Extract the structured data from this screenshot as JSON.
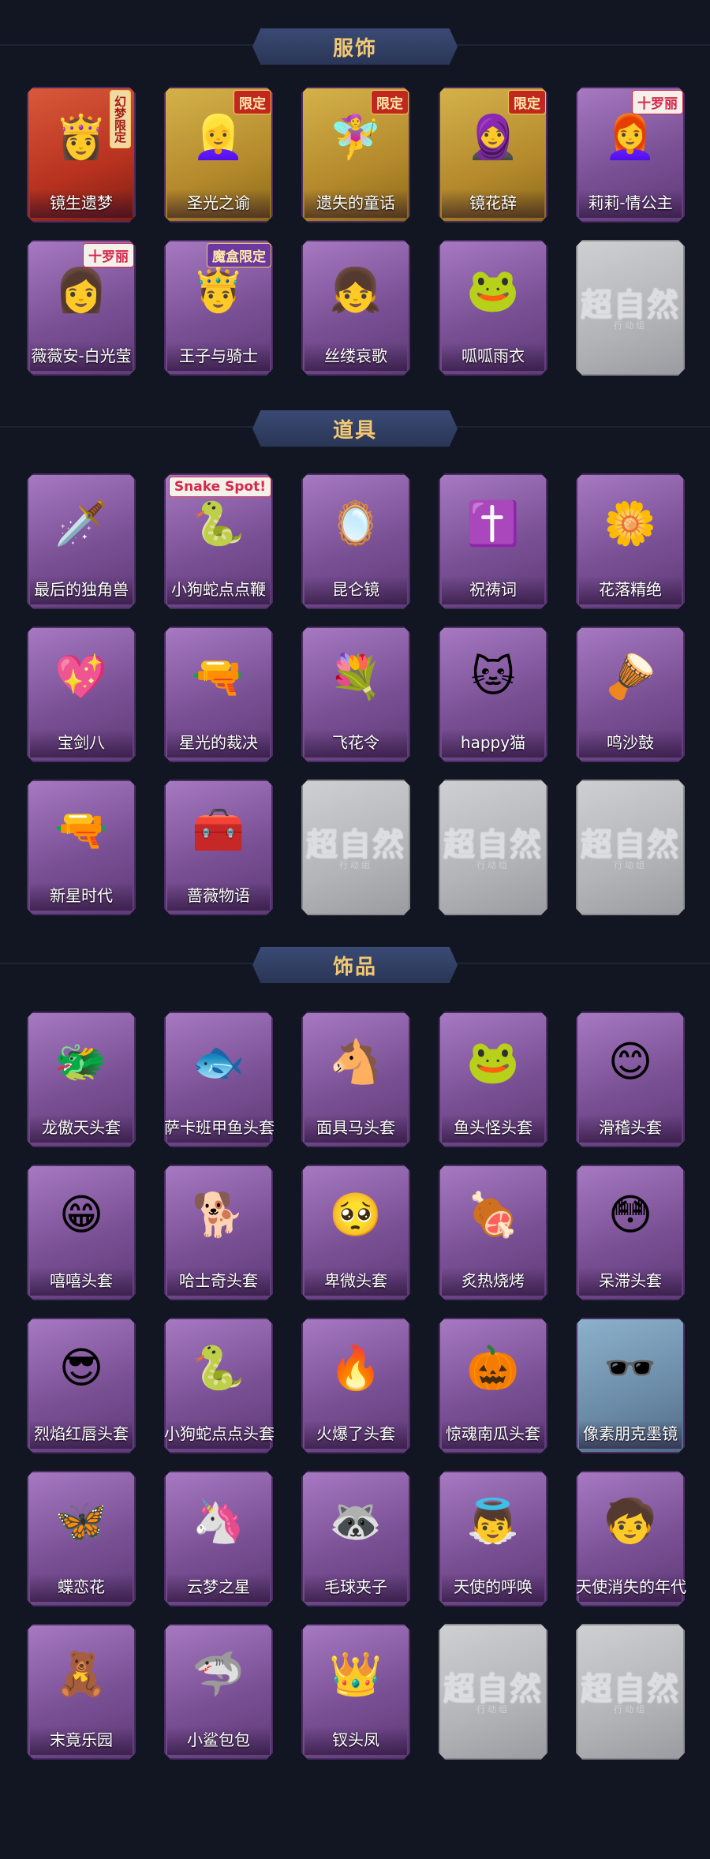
{
  "sections": [
    {
      "title": "服饰",
      "items": [
        {
          "label": "镜生遗梦",
          "icon": "👸",
          "style": "red",
          "badge": "幻梦限定",
          "badge_style": "vert"
        },
        {
          "label": "圣光之谕",
          "icon": "👱‍♀️",
          "style": "gold",
          "badge": "限定",
          "badge_style": ""
        },
        {
          "label": "遗失的童话",
          "icon": "🧚‍♀️",
          "style": "gold",
          "badge": "限定",
          "badge_style": ""
        },
        {
          "label": "镜花辞",
          "icon": "🧕",
          "style": "gold",
          "badge": "限定",
          "badge_style": ""
        },
        {
          "label": "莉莉-情公主",
          "icon": "👩‍🦰",
          "style": "purple",
          "badge": "十罗丽",
          "badge_style": "pink"
        },
        {
          "label": "薇薇安-白光莹",
          "icon": "👩",
          "style": "purple",
          "badge": "十罗丽",
          "badge_style": "pink"
        },
        {
          "label": "王子与骑士",
          "icon": "🤴",
          "style": "purple",
          "badge": "魔盒限定",
          "badge_style": "teal"
        },
        {
          "label": "丝缕哀歌",
          "icon": "👧",
          "style": "purple",
          "badge": "",
          "badge_style": ""
        },
        {
          "label": "呱呱雨衣",
          "icon": "🐸",
          "style": "purple",
          "badge": "",
          "badge_style": ""
        },
        {
          "label": "",
          "icon": "",
          "style": "grey",
          "badge": "",
          "badge_style": "",
          "placeholder": "超自然",
          "placeholder_sub": "行动组"
        }
      ]
    },
    {
      "title": "道具",
      "items": [
        {
          "label": "最后的独角兽",
          "icon": "🗡️",
          "style": "purple",
          "badge": "",
          "badge_style": ""
        },
        {
          "label": "小狗蛇点点鞭",
          "icon": "🐍",
          "style": "purple",
          "badge": "Snake Spot!",
          "badge_style": "pink"
        },
        {
          "label": "昆仑镜",
          "icon": "🪞",
          "style": "purple",
          "badge": "",
          "badge_style": ""
        },
        {
          "label": "祝祷词",
          "icon": "✝️",
          "style": "purple",
          "badge": "",
          "badge_style": ""
        },
        {
          "label": "花落精绝",
          "icon": "🌼",
          "style": "purple",
          "badge": "",
          "badge_style": ""
        },
        {
          "label": "宝剑八",
          "icon": "💖",
          "style": "purple",
          "badge": "",
          "badge_style": ""
        },
        {
          "label": "星光的裁决",
          "icon": "🔫",
          "style": "purple",
          "badge": "",
          "badge_style": ""
        },
        {
          "label": "飞花令",
          "icon": "💐",
          "style": "purple",
          "badge": "",
          "badge_style": ""
        },
        {
          "label": "happy猫",
          "icon": "🐱",
          "style": "purple",
          "badge": "",
          "badge_style": ""
        },
        {
          "label": "鸣沙鼓",
          "icon": "🪘",
          "style": "purple",
          "badge": "",
          "badge_style": ""
        },
        {
          "label": "新星时代",
          "icon": "🔫",
          "style": "purple",
          "badge": "",
          "badge_style": ""
        },
        {
          "label": "蔷薇物语",
          "icon": "🧰",
          "style": "purple",
          "badge": "",
          "badge_style": ""
        },
        {
          "label": "",
          "icon": "",
          "style": "grey",
          "badge": "",
          "badge_style": "",
          "placeholder": "超自然",
          "placeholder_sub": "行动组"
        },
        {
          "label": "",
          "icon": "",
          "style": "grey",
          "badge": "",
          "badge_style": "",
          "placeholder": "超自然",
          "placeholder_sub": "行动组"
        },
        {
          "label": "",
          "icon": "",
          "style": "grey",
          "badge": "",
          "badge_style": "",
          "placeholder": "超自然",
          "placeholder_sub": "行动组"
        }
      ]
    },
    {
      "title": "饰品",
      "items": [
        {
          "label": "龙傲天头套",
          "icon": "🐲",
          "style": "purple",
          "badge": "",
          "badge_style": ""
        },
        {
          "label": "萨卡班甲鱼头套",
          "icon": "🐟",
          "style": "purple",
          "badge": "",
          "badge_style": ""
        },
        {
          "label": "面具马头套",
          "icon": "🐴",
          "style": "purple",
          "badge": "",
          "badge_style": ""
        },
        {
          "label": "鱼头怪头套",
          "icon": "🐸",
          "style": "purple",
          "badge": "",
          "badge_style": ""
        },
        {
          "label": "滑稽头套",
          "icon": "😊",
          "style": "purple",
          "badge": "",
          "badge_style": ""
        },
        {
          "label": "嘻嘻头套",
          "icon": "😁",
          "style": "purple",
          "badge": "",
          "badge_style": ""
        },
        {
          "label": "哈士奇头套",
          "icon": "🐕",
          "style": "purple",
          "badge": "",
          "badge_style": ""
        },
        {
          "label": "卑微头套",
          "icon": "🥺",
          "style": "purple",
          "badge": "",
          "badge_style": ""
        },
        {
          "label": "炙热烧烤",
          "icon": "🍖",
          "style": "purple",
          "badge": "",
          "badge_style": ""
        },
        {
          "label": "呆滞头套",
          "icon": "😳",
          "style": "purple",
          "badge": "",
          "badge_style": ""
        },
        {
          "label": "烈焰红唇头套",
          "icon": "😎",
          "style": "purple",
          "badge": "",
          "badge_style": ""
        },
        {
          "label": "小狗蛇点点头套",
          "icon": "🐍",
          "style": "purple",
          "badge": "",
          "badge_style": ""
        },
        {
          "label": "火爆了头套",
          "icon": "🔥",
          "style": "purple",
          "badge": "",
          "badge_style": ""
        },
        {
          "label": "惊魂南瓜头套",
          "icon": "🎃",
          "style": "purple",
          "badge": "",
          "badge_style": ""
        },
        {
          "label": "像素朋克墨镜",
          "icon": "🕶️",
          "style": "blue",
          "badge": "",
          "badge_style": ""
        },
        {
          "label": "蝶恋花",
          "icon": "🦋",
          "style": "purple",
          "badge": "",
          "badge_style": ""
        },
        {
          "label": "云梦之星",
          "icon": "🦄",
          "style": "purple",
          "badge": "",
          "badge_style": ""
        },
        {
          "label": "毛球夹子",
          "icon": "🦝",
          "style": "purple",
          "badge": "",
          "badge_style": ""
        },
        {
          "label": "天使的呼唤",
          "icon": "👼",
          "style": "purple",
          "badge": "",
          "badge_style": ""
        },
        {
          "label": "天使消失的年代",
          "icon": "🧒",
          "style": "purple",
          "badge": "",
          "badge_style": ""
        },
        {
          "label": "末竟乐园",
          "icon": "🧸",
          "style": "purple",
          "badge": "",
          "badge_style": ""
        },
        {
          "label": "小鲨包包",
          "icon": "🦈",
          "style": "purple",
          "badge": "",
          "badge_style": ""
        },
        {
          "label": "钗头凤",
          "icon": "👑",
          "style": "purple",
          "badge": "",
          "badge_style": ""
        },
        {
          "label": "",
          "icon": "",
          "style": "grey",
          "badge": "",
          "badge_style": "",
          "placeholder": "超自然",
          "placeholder_sub": "行动组"
        },
        {
          "label": "",
          "icon": "",
          "style": "grey",
          "badge": "",
          "badge_style": "",
          "placeholder": "超自然",
          "placeholder_sub": "行动组"
        }
      ]
    }
  ],
  "header_ornament": "⟲"
}
